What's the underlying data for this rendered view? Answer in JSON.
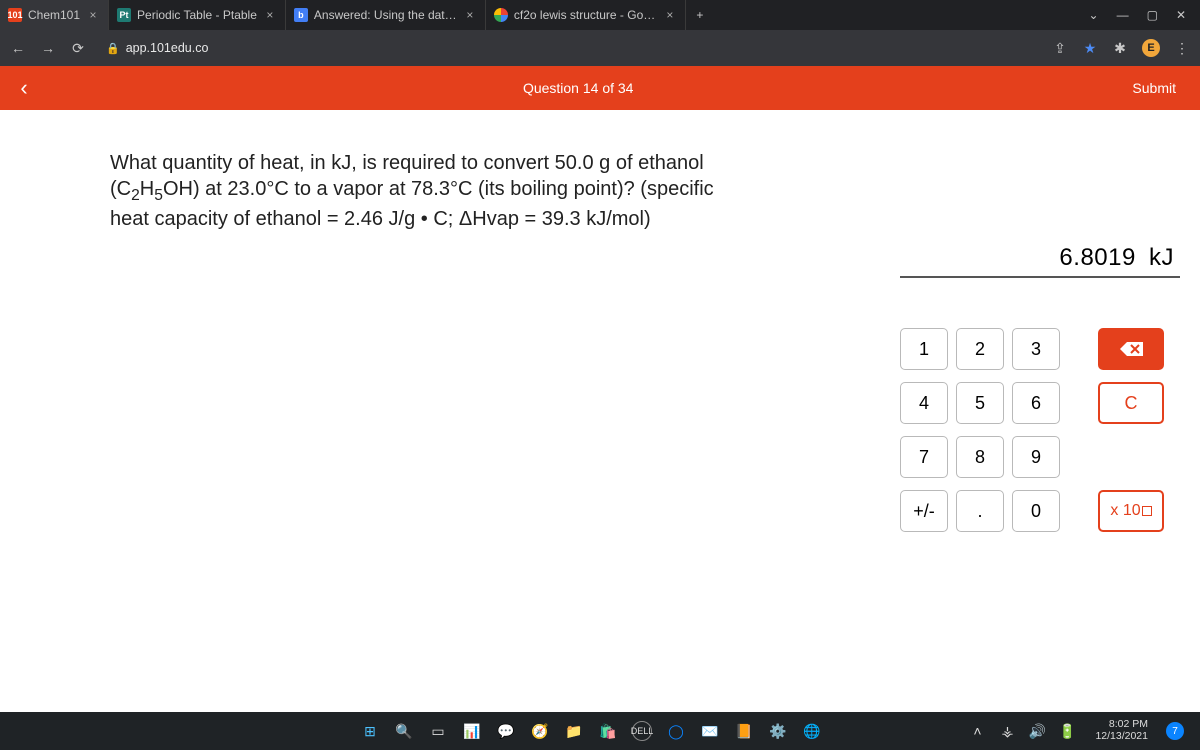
{
  "browser": {
    "tabs": [
      {
        "favicon": "101",
        "title": "Chem101"
      },
      {
        "favicon": "Pt",
        "title": "Periodic Table - Ptable"
      },
      {
        "favicon": "b",
        "title": "Answered: Using the data in the "
      },
      {
        "favicon": "G",
        "title": "cf2o lewis structure - Google Sea"
      }
    ],
    "url": "app.101edu.co"
  },
  "question": {
    "header_center": "Question 14 of 34",
    "submit_label": "Submit",
    "text_html": "What quantity of heat, in kJ, is required to convert 50.0 g of ethanol (C<span class='sub'>2</span>H<span class='sub'>5</span>OH) at 23.0°C to a vapor at 78.3°C (its boiling point)? (specific heat capacity of ethanol = 2.46 J/g • C; ΔHvap = 39.3 kJ/mol)"
  },
  "answer": {
    "value": "6.8019",
    "unit": "kJ"
  },
  "keypad": {
    "keys": {
      "k1": "1",
      "k2": "2",
      "k3": "3",
      "k4": "4",
      "k5": "5",
      "k6": "6",
      "k7": "7",
      "k8": "8",
      "k9": "9",
      "k0": "0",
      "dot": ".",
      "pm": "+/-",
      "clear": "C",
      "exp_prefix": "x 10"
    }
  },
  "system": {
    "time": "8:02 PM",
    "date": "12/13/2021",
    "notif_count": "7"
  }
}
